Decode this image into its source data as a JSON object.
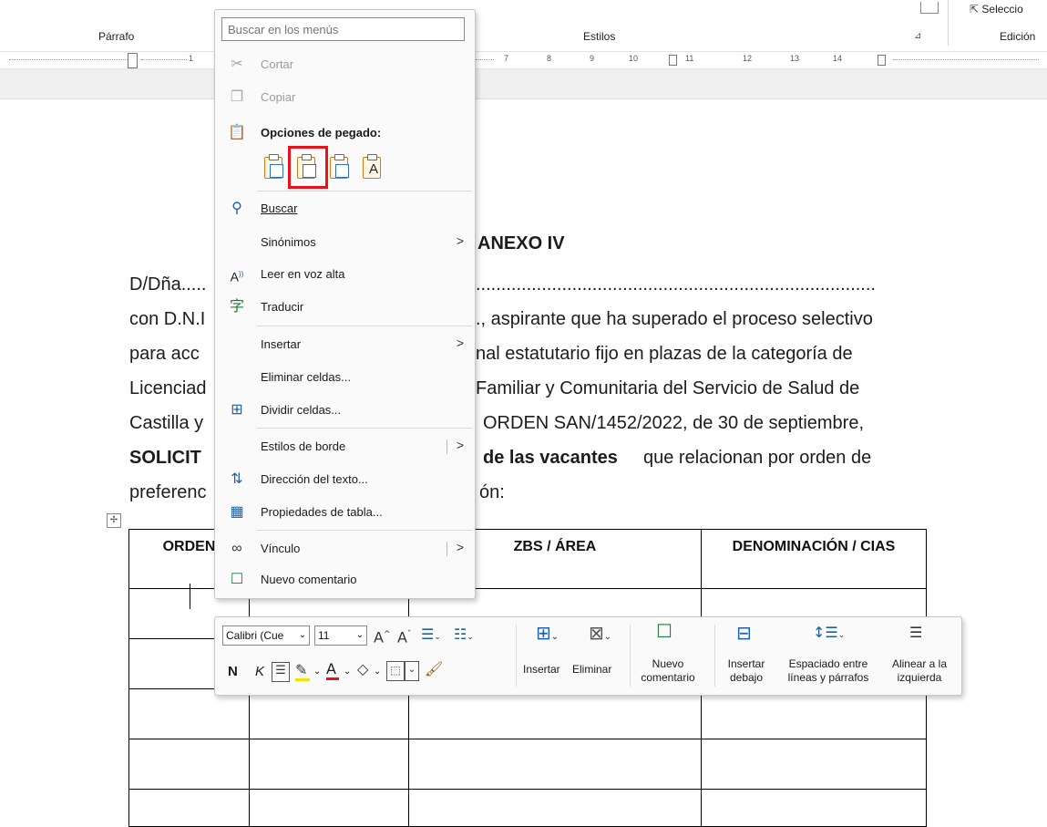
{
  "ribbon": {
    "group_paragraph": "Párrafo",
    "group_styles": "Estilos",
    "group_editing": "Edición",
    "select_label": "Seleccio",
    "launcher_icon": "dialog-launcher-icon"
  },
  "ruler": {
    "labels": [
      "1",
      "7",
      "8",
      "9",
      "10",
      "11",
      "12",
      "13",
      "14"
    ]
  },
  "document": {
    "heading": "ANEXO IV",
    "lines": [
      "D/Dña.....",
      "con D.N.I",
      "para acc",
      "Licenciad",
      "Castilla y",
      "SOLICIT",
      "preferenc"
    ],
    "right_lines": [
      "...............................................................................",
      "., aspirante que ha superado el proceso selectivo",
      "nal estatutario fijo en plazas de la categoría de",
      "Familiar y Comunitaria del Servicio de Salud de",
      "ORDEN SAN/1452/2022, de 30 de septiembre,",
      "de las vacantes",
      "que relacionan por orden de",
      "ón:"
    ],
    "table_headers": [
      "ORDEN",
      "",
      "ZBS / ÁREA",
      "DENOMINACIÓN / CIAS"
    ],
    "table_move_icon": "table-move-handle-icon"
  },
  "context_menu": {
    "search_placeholder": "Buscar en los menús",
    "cut": "Cortar",
    "copy": "Copiar",
    "paste_options_label": "Opciones de pegado:",
    "find": "Buscar",
    "synonyms": "Sinónimos",
    "read_aloud": "Leer en voz alta",
    "translate": "Traducir",
    "insert": "Insertar",
    "delete_cells": "Eliminar celdas...",
    "split_cells": "Dividir celdas...",
    "border_styles": "Estilos de borde",
    "text_direction": "Dirección del texto...",
    "table_properties": "Propiedades de tabla...",
    "link": "Vínculo",
    "new_comment": "Nuevo comentario",
    "submenu_arrow": ">"
  },
  "mini_toolbar": {
    "font_name": "Calibri (Cue",
    "font_size": "11",
    "bold_label": "N",
    "italic_label": "K",
    "insert_label": "Insertar",
    "delete_label": "Eliminar",
    "new_comment_label": [
      "Nuevo",
      "comentario"
    ],
    "insert_below_label": [
      "Insertar",
      "debajo"
    ],
    "spacing_label": [
      "Espaciado entre",
      "líneas y párrafos"
    ],
    "align_left_label": [
      "Alinear a la",
      "izquierda"
    ],
    "highlight_color": "#f2e600",
    "font_color": "#e8111c"
  },
  "colors": {
    "highlight_box": "#e8111c",
    "accent": "#1f5fa8"
  }
}
